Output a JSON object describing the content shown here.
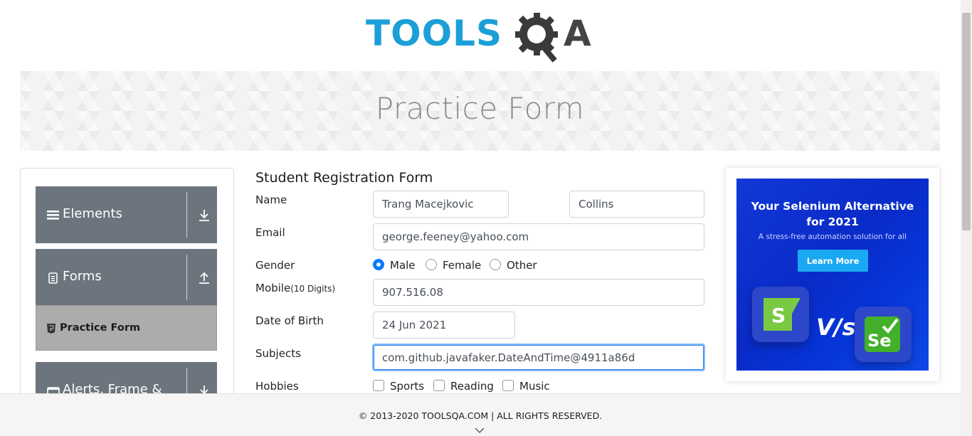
{
  "logo": {
    "text_main": "TOOLS",
    "text_end": "A",
    "gear_letter": "Q"
  },
  "banner": {
    "title": "Practice Form"
  },
  "sidebar": {
    "groups": [
      {
        "label": "Elements",
        "icon": "hamburger-icon",
        "toggle": "download-arrow-icon"
      },
      {
        "label": "Forms",
        "icon": "document-icon",
        "toggle": "upload-arrow-icon"
      },
      {
        "label": "Alerts, Frame & Windows",
        "icon": "window-icon",
        "toggle": "download-arrow-icon"
      }
    ],
    "active_item": {
      "label": "Practice Form",
      "icon": "html-badge-icon"
    }
  },
  "form": {
    "title": "Student Registration Form",
    "name_label": "Name",
    "first_name": "Trang Macejkovic",
    "last_name": "Collins",
    "email_label": "Email",
    "email": "george.feeney@yahoo.com",
    "gender_label": "Gender",
    "gender_options": [
      "Male",
      "Female",
      "Other"
    ],
    "gender_selected": "Male",
    "mobile_label": "Mobile",
    "mobile_hint": "(10 Digits)",
    "mobile": "907.516.08",
    "dob_label": "Date of Birth",
    "dob": "24 Jun 2021",
    "subjects_label": "Subjects",
    "subjects": "com.github.javafaker.DateAndTime@4911a86d",
    "hobbies_label": "Hobbies",
    "hobbies": [
      "Sports",
      "Reading",
      "Music"
    ]
  },
  "ad": {
    "headline_1": "Your Selenium Alternative",
    "headline_2": "for 2021",
    "sub": "A stress-free automation solution for all",
    "button": "Learn More",
    "vs": "V/s",
    "tile_left": "S",
    "tile_right": "Se"
  },
  "footer": {
    "text": "© 2013-2020 TOOLSQA.COM | ALL RIGHTS RESERVED."
  },
  "colors": {
    "brand_blue": "#1c9fd8",
    "sidebar_group": "#6c757d",
    "active_item": "#acacac",
    "radio_checked": "#007bff"
  }
}
